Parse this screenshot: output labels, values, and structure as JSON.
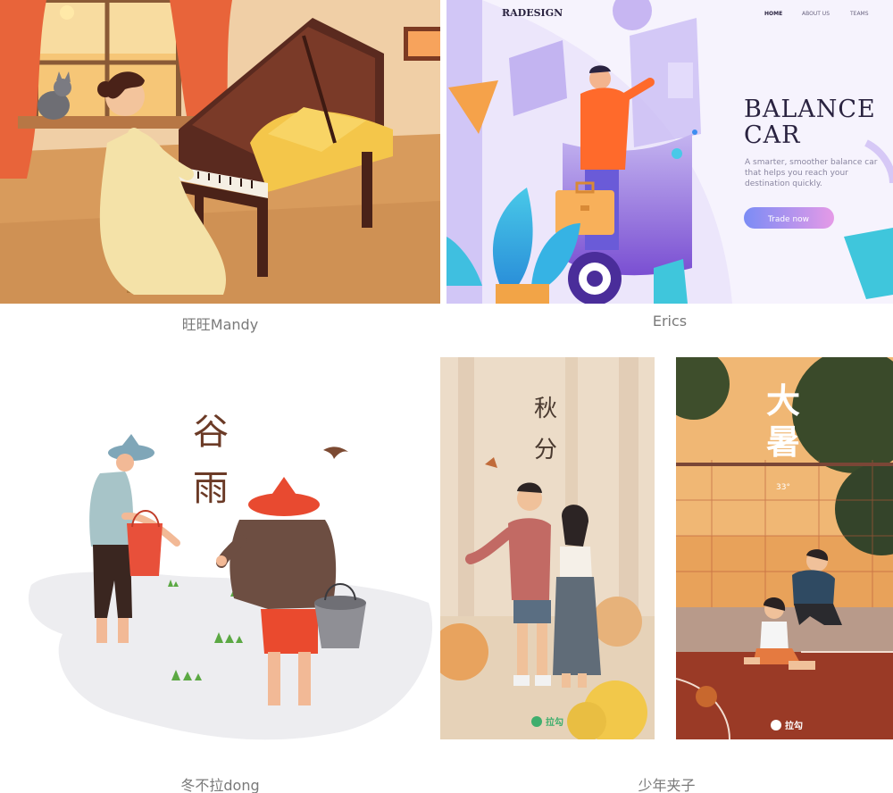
{
  "gallery": {
    "items": [
      {
        "caption": "旺旺Mandy"
      },
      {
        "caption": "Erics",
        "nav": {
          "logo": "RADESIGN",
          "links": [
            "HOME",
            "ABOUT US",
            "TEAMS"
          ]
        },
        "hero": {
          "title_line1": "BALANCE",
          "title_line2": "CAR",
          "desc_line1": "A smarter, smoother balance car",
          "desc_line2": "that helps you reach your",
          "desc_line3": "destination quickly.",
          "cta": "Trade now"
        }
      },
      {
        "caption": "冬不拉dong",
        "poster_title_1": "谷",
        "poster_title_2": "雨"
      },
      {
        "caption": "少年夹子",
        "left_title_1": "秋",
        "left_title_2": "分",
        "left_brand": "拉勾",
        "right_title_1": "大",
        "right_title_2": "暑",
        "right_temp": "33°",
        "right_brand": "拉勾"
      }
    ]
  },
  "colors": {
    "caption_text": "#7a7a7a",
    "piano_wall": "#f1d0a8",
    "radesign_bg": "#f2eefc",
    "cta_gradient_start": "#7b8cf5",
    "cta_gradient_end": "#e59ae7",
    "autumn_bg": "#ecdcc8",
    "summer_bg": "#e8a25a"
  }
}
